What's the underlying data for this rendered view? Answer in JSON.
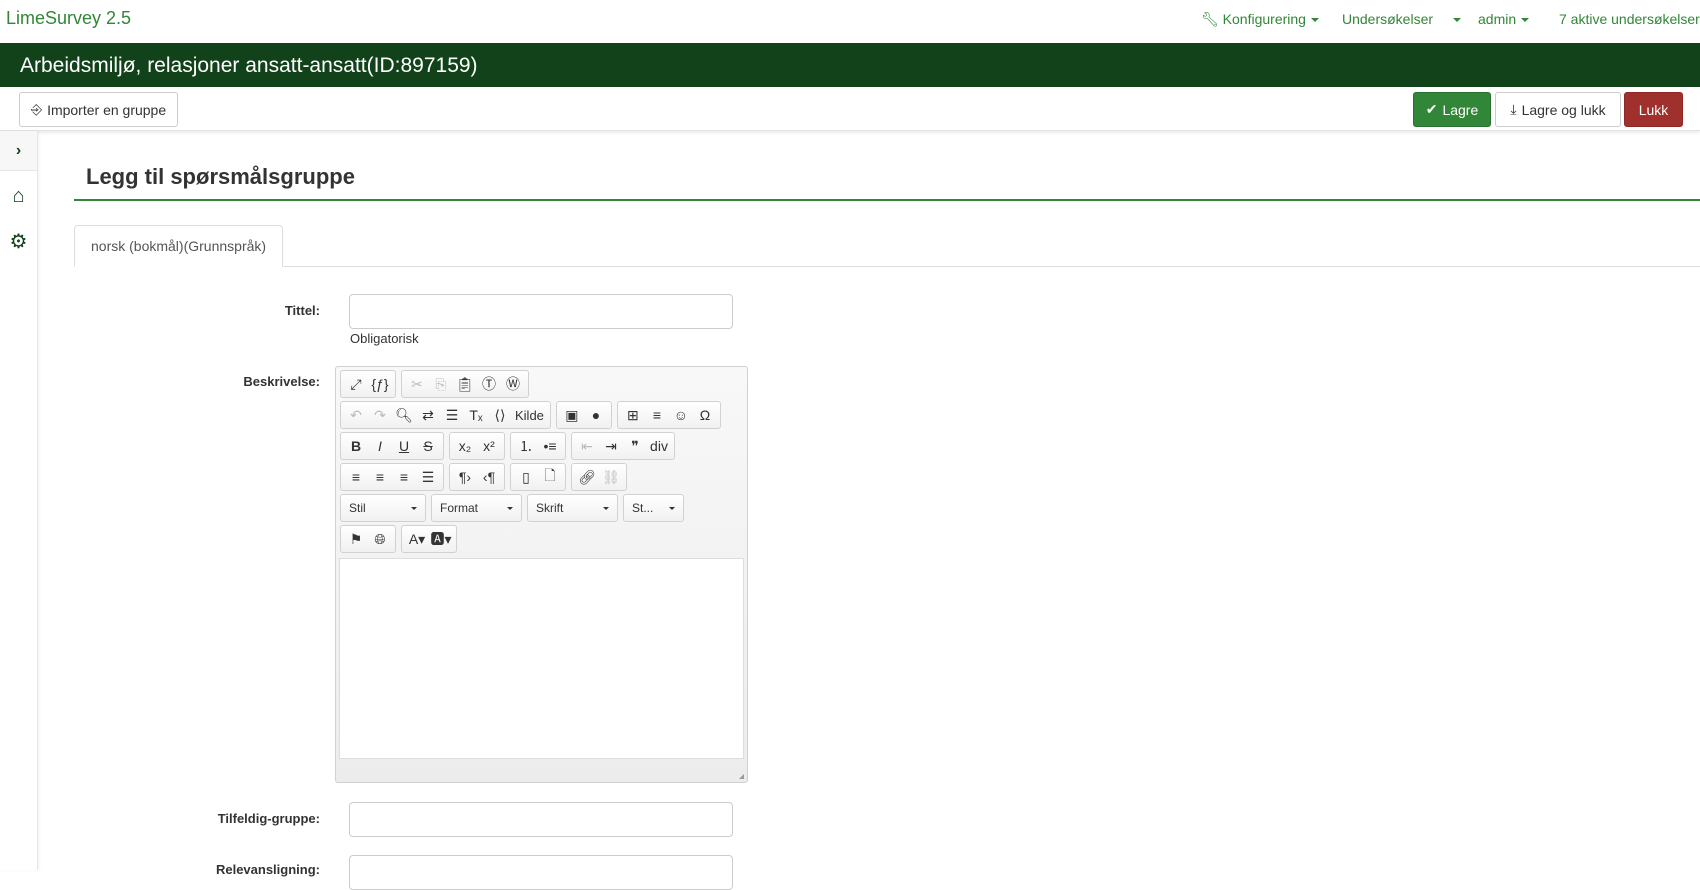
{
  "topnav": {
    "brand": "LimeSurvey 2.5",
    "items": [
      "Konfigurering",
      "Undersøkelser",
      "admin",
      "7 aktive undersøkelser"
    ]
  },
  "survey_title": "Arbeidsmiljø, relasjoner ansatt-ansatt(ID:897159)",
  "toolbar": {
    "import_label": "Importer en gruppe",
    "save_label": "Lagre",
    "save_close_label": "Lagre og lukk",
    "close_label": "Lukk"
  },
  "page_title": "Legg til spørsmålsgruppe",
  "tab_label": "norsk (bokmål)(Grunnspråk)",
  "form": {
    "title_label": "Tittel:",
    "title_value": "",
    "title_help": "Obligatorisk",
    "description_label": "Beskrivelse:",
    "random_group_label": "Tilfeldig-gruppe:",
    "random_group_value": "",
    "relevance_label": "Relevansligning:",
    "relevance_value": ""
  },
  "editor": {
    "toolbar_rows": [
      [
        [
          "maximize",
          "expressions"
        ],
        [
          "cut",
          "copy",
          "paste",
          "paste-text",
          "paste-word"
        ]
      ],
      [
        [
          "undo",
          "redo",
          "find",
          "replace",
          "select-all",
          "remove-format",
          "source"
        ],
        [
          "image",
          "flash"
        ],
        [
          "table",
          "horizontal-rule",
          "smiley",
          "special-char"
        ]
      ],
      [
        [
          "bold",
          "italic",
          "underline",
          "strike"
        ],
        [
          "subscript",
          "superscript"
        ],
        [
          "numbered-list",
          "bulleted-list"
        ],
        [
          "outdent",
          "indent",
          "blockquote",
          "create-div"
        ]
      ],
      [
        [
          "align-left",
          "align-center",
          "align-right",
          "justify"
        ],
        [
          "ltr",
          "rtl"
        ],
        [
          "templates",
          "new-page"
        ],
        [
          "link",
          "unlink"
        ]
      ]
    ],
    "source_label": "Kilde",
    "combos": [
      "Stil",
      "Format",
      "Skrift",
      "St..."
    ],
    "bottom_row": [
      [
        "language",
        "bidi"
      ],
      [
        "text-color",
        "bg-color"
      ]
    ]
  },
  "colors": {
    "brand": "#328637",
    "titlebar": "#11421a",
    "danger": "#a0302b"
  }
}
